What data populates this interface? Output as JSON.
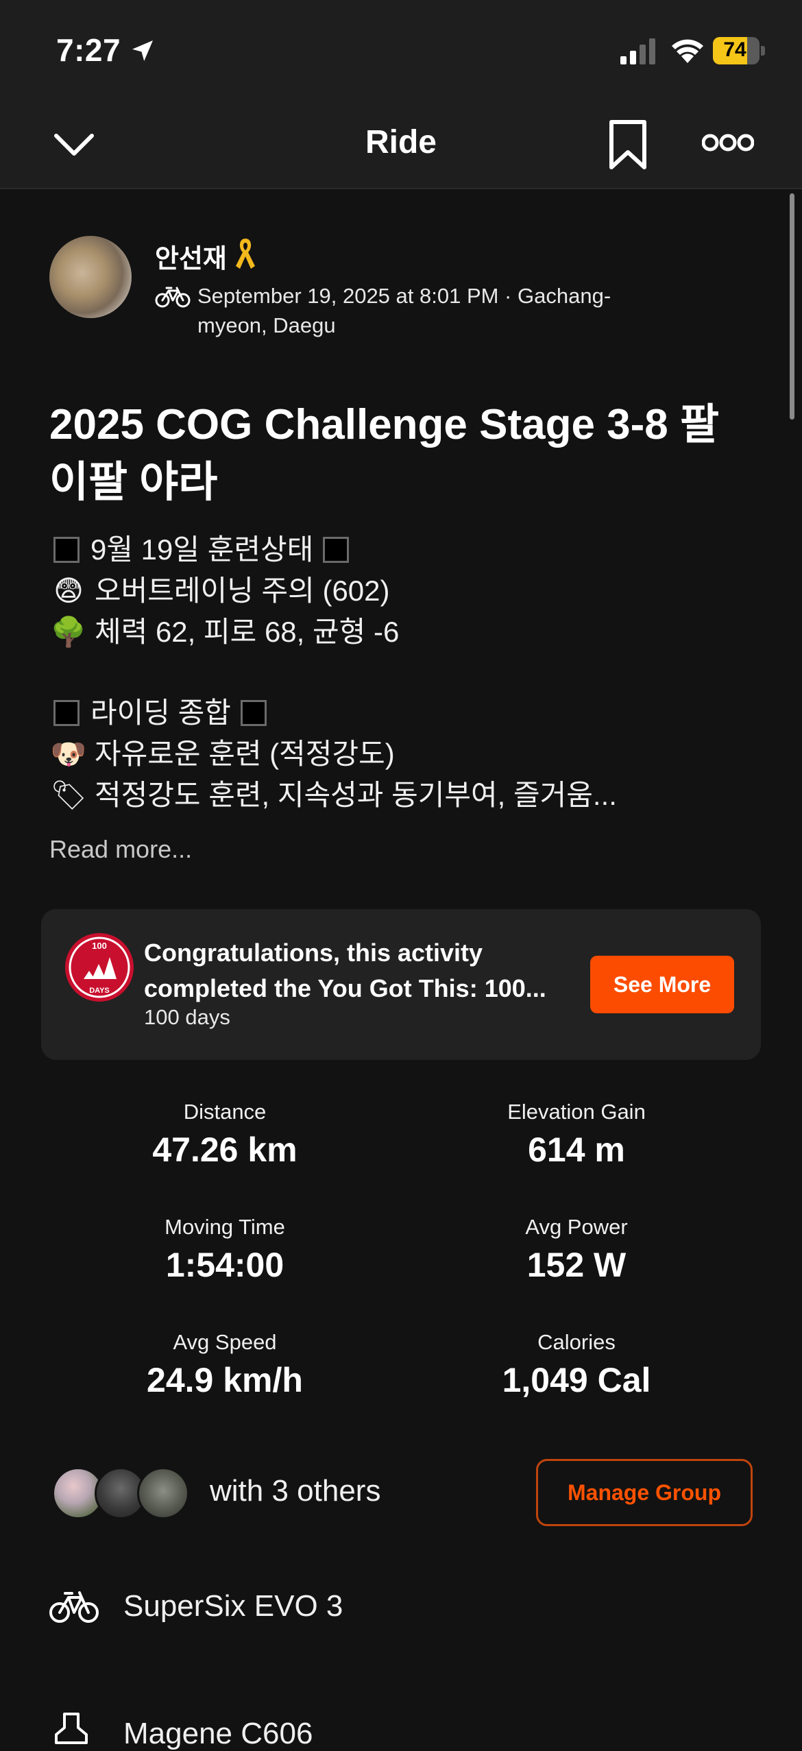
{
  "status_bar": {
    "time": "7:27",
    "battery": "74",
    "battery_level": 0.74
  },
  "nav": {
    "title": "Ride"
  },
  "activity": {
    "athlete_name": "안선재",
    "meta": "September 19, 2025 at 8:01 PM · Gachang-myeon, Daegu",
    "title": "2025 COG Challenge Stage 3-8 팔이팔 야라",
    "description": [
      {
        "icon": "black-square",
        "text": "9월 19일 훈련상태",
        "trail": "black-square"
      },
      {
        "icon": "fearful-face-emoji",
        "emoji": "😨",
        "text": "오버트레이닝 주의 (602)"
      },
      {
        "icon": "tree-emoji",
        "emoji": "🌳",
        "text": "체력 62, 피로 68, 균형 -6"
      },
      {
        "icon": "black-square",
        "text": "라이딩 종합",
        "trail": "black-square"
      },
      {
        "icon": "dog-face-emoji",
        "emoji": "🐶",
        "text": "자유로운 훈련 (적정강도)"
      },
      {
        "icon": "label-tag-emoji",
        "emoji": "🏷",
        "text": "적정강도 훈련, 지속성과 동기부여, 즐거움..."
      }
    ],
    "read_more": "Read more..."
  },
  "achievement": {
    "badge_top": "100",
    "badge_bottom": "DAYS",
    "title": "Congratulations, this activity completed the You Got This: 100...",
    "subtitle": "100 days",
    "button": "See More"
  },
  "stats": [
    {
      "label": "Distance",
      "value": "47.26 km"
    },
    {
      "label": "Elevation Gain",
      "value": "614 m"
    },
    {
      "label": "Moving Time",
      "value": "1:54:00"
    },
    {
      "label": "Avg Power",
      "value": "152 W"
    },
    {
      "label": "Avg Speed",
      "value": "24.9 km/h"
    },
    {
      "label": "Calories",
      "value": "1,049 Cal"
    }
  ],
  "group": {
    "text": "with 3 others",
    "button": "Manage Group"
  },
  "gear": {
    "bike": "SuperSix EVO 3",
    "shoes": "Magene C606"
  },
  "colors": {
    "accent": "#fc4c02",
    "background": "#121212",
    "bar": "#1e1e1e",
    "card": "#222222"
  }
}
